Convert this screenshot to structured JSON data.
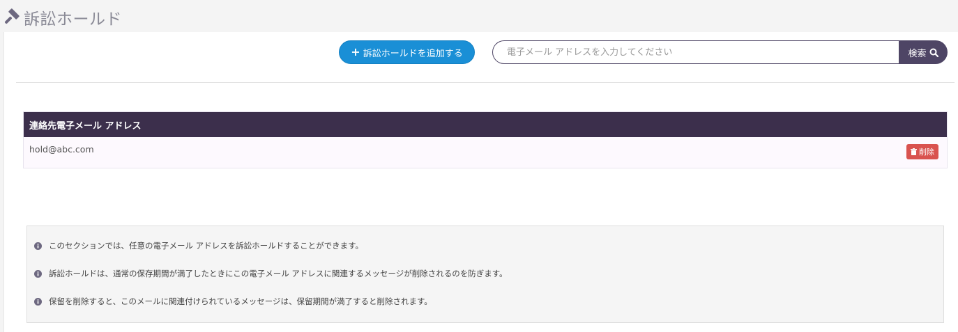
{
  "header": {
    "title": "訴訟ホールド",
    "icon": "gavel-icon"
  },
  "toolbar": {
    "add_label": "訴訟ホールドを追加する",
    "search_placeholder": "電子メール アドレスを入力してください",
    "search_label": "検索"
  },
  "table": {
    "column_header": "連絡先電子メール アドレス",
    "rows": [
      {
        "email": "hold@abc.com",
        "delete_label": "削除"
      }
    ]
  },
  "info": {
    "items": [
      "このセクションでは、任意の電子メール アドレスを訴訟ホールドすることができます。",
      "訴訟ホールドは、通常の保存期間が満了したときにこの電子メール アドレスに関連するメッセージが削除されるのを防ぎます。",
      "保留を削除すると、このメールに関連付けられているメッセージは、保留期間が満了すると削除されます。"
    ]
  },
  "colors": {
    "primary_button": "#1a8fd6",
    "search_button": "#4e4565",
    "table_header": "#3c2f4c",
    "delete_button": "#d9534f"
  }
}
